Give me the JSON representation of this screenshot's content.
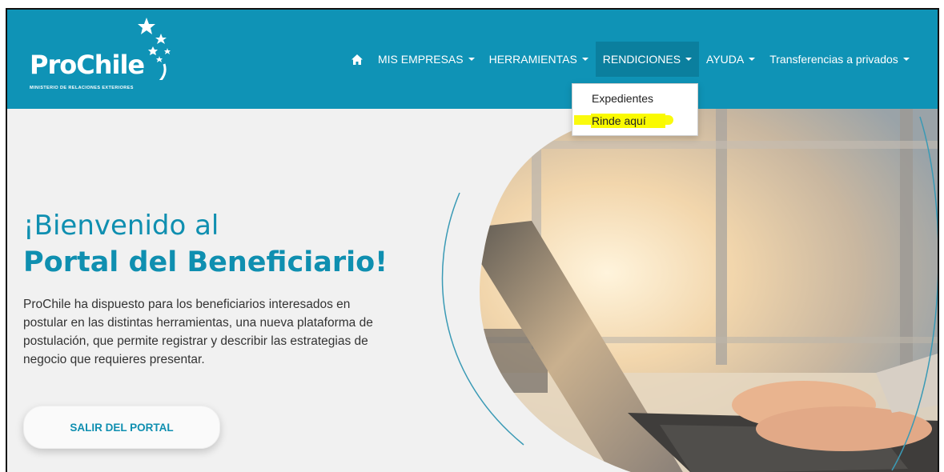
{
  "brand": {
    "name": "ProChile",
    "subtitle": "MINISTERIO DE RELACIONES EXTERIORES"
  },
  "nav": {
    "home_icon": "home-icon",
    "items": [
      {
        "label": "MIS EMPRESAS"
      },
      {
        "label": "HERRAMIENTAS"
      },
      {
        "label": "RENDICIONES"
      },
      {
        "label": "AYUDA"
      },
      {
        "label": "Transferencias a privados"
      }
    ]
  },
  "dropdown": {
    "items": [
      {
        "label": "Expedientes"
      },
      {
        "label": "Rinde aquí"
      }
    ]
  },
  "hero": {
    "title_line1": "¡Bienvenido al",
    "title_line2": "Portal del Beneficiario!",
    "description": "ProChile ha dispuesto para los beneficiarios interesados en postular en las distintas herramientas, una nueva plataforma de postulación, que permite registrar y describir las estrategias de negocio que requieres presentar.",
    "button_label": "SALIR DEL PORTAL"
  },
  "colors": {
    "header": "#0f93b6",
    "active_nav": "#0b7f9e",
    "accent_text": "#0f8fb0",
    "highlight": "#fafa00"
  }
}
